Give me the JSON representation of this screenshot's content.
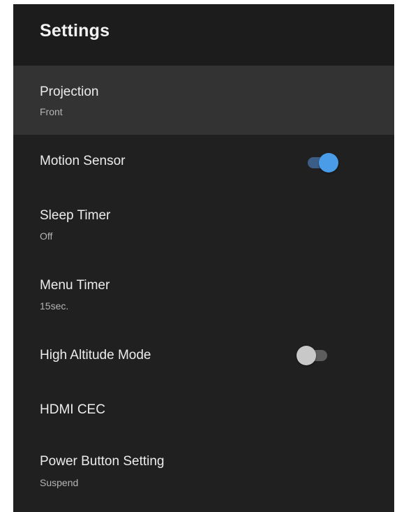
{
  "header": {
    "title": "Settings"
  },
  "items": [
    {
      "label": "Projection",
      "value": "Front"
    },
    {
      "label": "Motion Sensor",
      "toggle": "on"
    },
    {
      "label": "Sleep Timer",
      "value": "Off"
    },
    {
      "label": "Menu Timer",
      "value": "15sec."
    },
    {
      "label": "High Altitude Mode",
      "toggle": "off"
    },
    {
      "label": "HDMI CEC"
    },
    {
      "label": "Power Button Setting",
      "value": "Suspend"
    }
  ],
  "colors": {
    "background": "#202020",
    "selected_row": "#333333",
    "toggle_on_thumb": "#4a9be8",
    "toggle_on_track": "#3c5d86",
    "toggle_off_thumb": "#c8c8c8",
    "toggle_off_track": "#5d5d5d"
  }
}
